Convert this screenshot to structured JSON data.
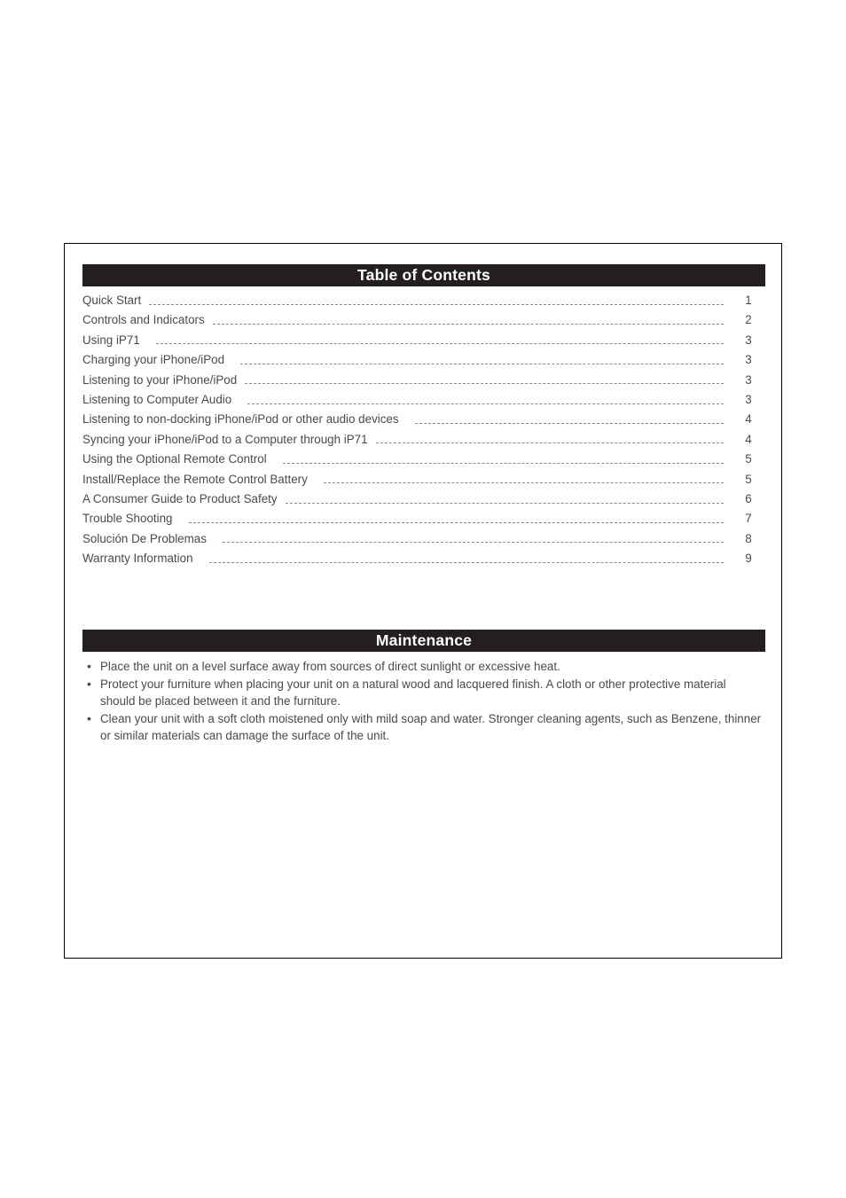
{
  "document": {
    "page_background": "#ffffff",
    "border_color": "#000000",
    "bar_color": "#231f20",
    "bar_text_color": "#ffffff",
    "body_text_color": "#4a4a4a",
    "leader_color": "#8a8a8a"
  },
  "toc": {
    "heading": "Table of Contents",
    "entries": [
      {
        "title": "Quick Start",
        "page": "1",
        "wide_gap": false
      },
      {
        "title": "Controls and Indicators",
        "page": "2",
        "wide_gap": false
      },
      {
        "title": "Using iP71",
        "page": "3",
        "wide_gap": true
      },
      {
        "title": "Charging your iPhone/iPod",
        "page": "3",
        "wide_gap": true
      },
      {
        "title": "Listening to your iPhone/iPod",
        "page": "3",
        "wide_gap": false
      },
      {
        "title": "Listening to Computer Audio",
        "page": "3",
        "wide_gap": true
      },
      {
        "title": "Listening to non-docking iPhone/iPod or other audio devices",
        "page": "4",
        "wide_gap": true
      },
      {
        "title": "Syncing your iPhone/iPod to a Computer through iP71",
        "page": "4",
        "wide_gap": false
      },
      {
        "title": "Using the Optional Remote Control",
        "page": "5",
        "wide_gap": true
      },
      {
        "title": "Install/Replace the Remote Control Battery",
        "page": "5",
        "wide_gap": true
      },
      {
        "title": "A Consumer Guide to Product Safety",
        "page": "6",
        "wide_gap": false
      },
      {
        "title": "Trouble Shooting",
        "page": "7",
        "wide_gap": true
      },
      {
        "title": "Solución De Problemas",
        "page": "8",
        "wide_gap": true
      },
      {
        "title": "Warranty Information",
        "page": "9",
        "wide_gap": true
      }
    ]
  },
  "maintenance": {
    "heading": "Maintenance",
    "bullet_glyph": "•",
    "items": [
      "Place the unit on a level surface away from sources of direct sunlight or excessive heat.",
      "Protect your furniture when placing your unit on a natural wood and lacquered finish. A cloth or other protective material should be placed between it and the furniture.",
      "Clean your unit with a soft cloth moistened only with mild soap and water. Stronger cleaning agents, such as Benzene, thinner or similar materials can damage the surface of the unit."
    ]
  }
}
